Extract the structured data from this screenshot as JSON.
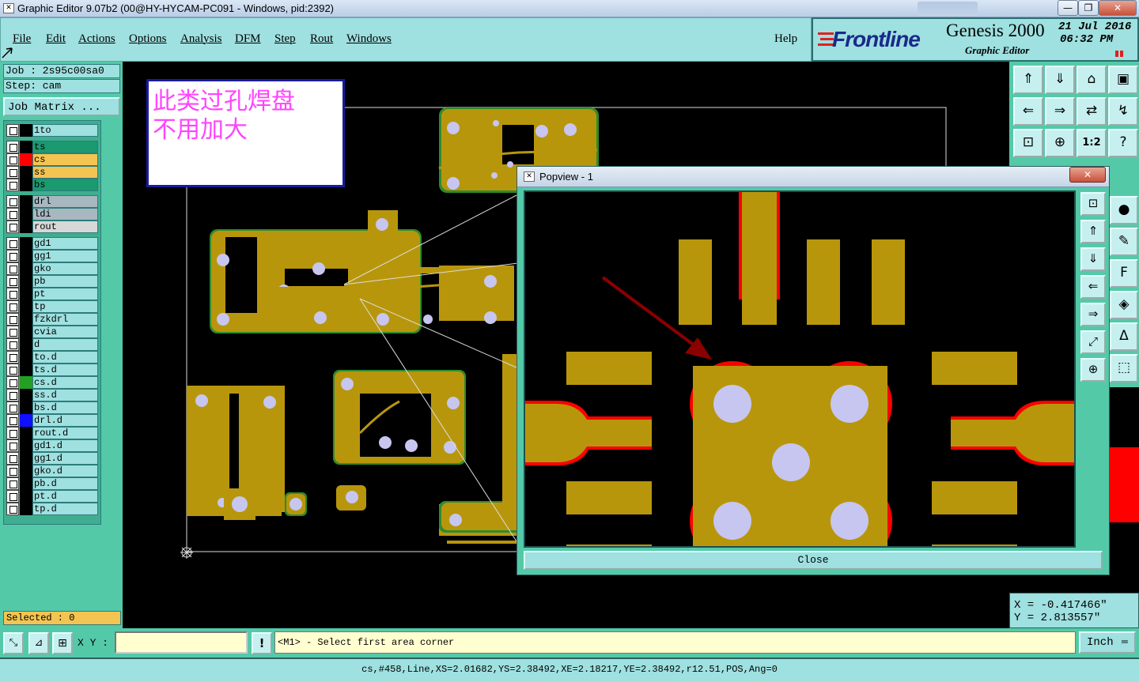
{
  "window": {
    "title": "Graphic Editor 9.07b2 (00@HY-HYCAM-PC091 - Windows, pid:2392)",
    "minimize_glyph": "—",
    "restore_glyph": "❐",
    "close_glyph": "✕"
  },
  "menu": {
    "items": [
      "File",
      "Edit",
      "Actions",
      "Options",
      "Analysis",
      "DFM",
      "Step",
      "Rout",
      "Windows"
    ],
    "help": "Help"
  },
  "brand": {
    "logo": "Frontline",
    "product": "Genesis 2000",
    "subtitle": "Graphic Editor",
    "date": "21 Jul 2016",
    "time": "06:32 PM"
  },
  "job": {
    "job_label": "Job : 2s95c00sa0",
    "step_label": "Step: cam",
    "matrix_button": "Job Matrix ..."
  },
  "layers": [
    {
      "name": "1to",
      "color": "#9fe0e0",
      "swatch": "#000000"
    },
    {
      "name": "ts",
      "color": "#1a9a6e",
      "swatch": "#000000"
    },
    {
      "name": "cs",
      "color": "#f3c452",
      "swatch": "#ff0000"
    },
    {
      "name": "ss",
      "color": "#f3c452",
      "swatch": "#000000"
    },
    {
      "name": "bs",
      "color": "#1a9a6e",
      "swatch": "#000000"
    },
    {
      "name": "drl",
      "color": "#a8b8c0",
      "swatch": "#000000"
    },
    {
      "name": "ldi",
      "color": "#a8b8c0",
      "swatch": "#000000"
    },
    {
      "name": "rout",
      "color": "#d8d8d8",
      "swatch": "#000000"
    },
    {
      "name": "gd1",
      "color": "#9fe0e0",
      "swatch": "#000000"
    },
    {
      "name": "gg1",
      "color": "#9fe0e0",
      "swatch": "#000000"
    },
    {
      "name": "gko",
      "color": "#9fe0e0",
      "swatch": "#000000"
    },
    {
      "name": "pb",
      "color": "#9fe0e0",
      "swatch": "#000000"
    },
    {
      "name": "pt",
      "color": "#9fe0e0",
      "swatch": "#000000"
    },
    {
      "name": "tp",
      "color": "#9fe0e0",
      "swatch": "#000000"
    },
    {
      "name": "fzkdrl",
      "color": "#9fe0e0",
      "swatch": "#000000"
    },
    {
      "name": "cvia",
      "color": "#9fe0e0",
      "swatch": "#000000"
    },
    {
      "name": "d",
      "color": "#9fe0e0",
      "swatch": "#000000"
    },
    {
      "name": "to.d",
      "color": "#9fe0e0",
      "swatch": "#000000"
    },
    {
      "name": "ts.d",
      "color": "#9fe0e0",
      "swatch": "#000000"
    },
    {
      "name": "cs.d",
      "color": "#9fe0e0",
      "swatch": "#22a022"
    },
    {
      "name": "ss.d",
      "color": "#9fe0e0",
      "swatch": "#000000"
    },
    {
      "name": "bs.d",
      "color": "#9fe0e0",
      "swatch": "#000000"
    },
    {
      "name": "drl.d",
      "color": "#9fe0e0",
      "swatch": "#1010ff"
    },
    {
      "name": "rout.d",
      "color": "#9fe0e0",
      "swatch": "#000000"
    },
    {
      "name": "gd1.d",
      "color": "#9fe0e0",
      "swatch": "#000000"
    },
    {
      "name": "gg1.d",
      "color": "#9fe0e0",
      "swatch": "#000000"
    },
    {
      "name": "gko.d",
      "color": "#9fe0e0",
      "swatch": "#000000"
    },
    {
      "name": "pb.d",
      "color": "#9fe0e0",
      "swatch": "#000000"
    },
    {
      "name": "pt.d",
      "color": "#9fe0e0",
      "swatch": "#000000"
    },
    {
      "name": "tp.d",
      "color": "#9fe0e0",
      "swatch": "#000000"
    }
  ],
  "selected": "Selected : 0",
  "annotation": {
    "line1": "此类过孔焊盘",
    "line2": "不用加大"
  },
  "popview": {
    "title": "Popview - 1",
    "close_button": "Close"
  },
  "coords": {
    "x": "X = -0.417466\"",
    "y": "Y = 2.813557\""
  },
  "bottom": {
    "xy_label": "X Y :",
    "prompt": "<M1> - Select first area corner",
    "units": "Inch"
  },
  "status_line": "cs,#458,Line,XS=2.01682,YS=2.38492,XE=2.18217,YE=2.38492,r12.51,POS,Ang=0",
  "colors": {
    "copper": "#b8960c",
    "pad_hole": "#c6c6f0",
    "solder_mask_open": "#ff0000",
    "board_green": "#2e8b2e",
    "panel_teal": "#54c9a8",
    "panel_light": "#9fe0e0",
    "annotation_magenta": "#ff44ff",
    "arrow": "#8b0000"
  },
  "tool_icons": [
    "zoom-home-icon",
    "zoom-back-icon",
    "zoom-home2-icon",
    "window-icon",
    "pan-left-icon",
    "pan-right-icon",
    "flip-icon",
    "snap-icon",
    "fit-icon",
    "center-icon",
    "scale-1to2-icon",
    "help-icon"
  ],
  "popup_icons": [
    "popup-zoom-icon",
    "popup-up-icon",
    "popup-down-icon",
    "popup-left-icon",
    "popup-right-icon",
    "popup-fit-icon",
    "popup-center-icon"
  ]
}
